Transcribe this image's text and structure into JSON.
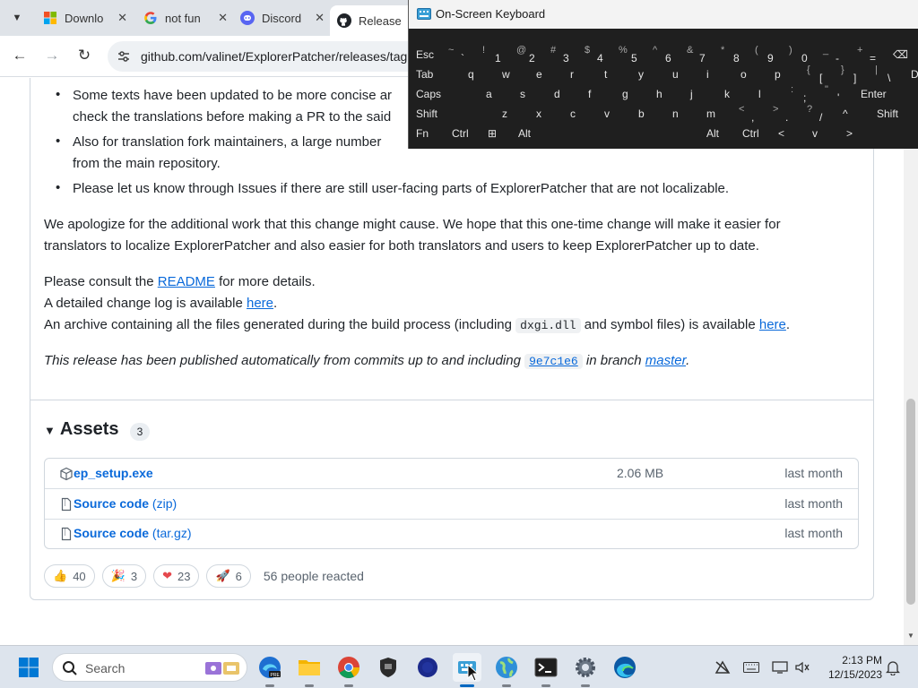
{
  "browser": {
    "tabs": [
      {
        "label": "Downlo",
        "icon": "windows-logo-icon",
        "active": false
      },
      {
        "label": "not fun",
        "icon": "google-icon",
        "active": false
      },
      {
        "label": "Discord",
        "icon": "discord-icon",
        "active": false
      },
      {
        "label": "Release",
        "icon": "github-icon",
        "active": true
      }
    ],
    "close_glyph": "✕",
    "url": "github.com/valinet/ExplorerPatcher/releases/tag"
  },
  "release": {
    "bullet_1": {
      "line_1": "Some texts have been updated to be more concise ar",
      "line_2": "check the translations before making a PR to the said"
    },
    "bullet_2": {
      "line_1": "Also for translation fork maintainers, a large number",
      "line_2": "from the main repository."
    },
    "bullet_3": "Please let us know through Issues if there are still user-facing parts of ExplorerPatcher that are not localizable.",
    "apology_line_1": "We apologize for the additional work that this change might cause. We hope that this one-time change will make it easier for",
    "apology_line_2": "translators to localize ExplorerPatcher and also easier for both translators and users to keep ExplorerPatcher up to date.",
    "consult": {
      "before": "Please consult the ",
      "link": "README",
      "after": " for more details."
    },
    "changelog": {
      "before": "A detailed change log is available ",
      "link": "here",
      "after": "."
    },
    "archive": {
      "before": "An archive containing all the files generated during the build process (including ",
      "code": "dxgi.dll",
      "middle": " and symbol files) is available ",
      "link": "here",
      "after": "."
    },
    "published": {
      "before": "This release has been published automatically from commits up to and including ",
      "sha": "9e7c1e6",
      "middle": " in branch ",
      "branch": "master",
      "after": "."
    }
  },
  "assets": {
    "title": "Assets",
    "count": "3",
    "rows": [
      {
        "name": "ep_setup.exe",
        "sub": "",
        "size": "2.06 MB",
        "date": "last month",
        "icon": "package-icon"
      },
      {
        "name": "Source code",
        "sub": " (zip)",
        "size": "",
        "date": "last month",
        "icon": "file-zip-icon"
      },
      {
        "name": "Source code",
        "sub": " (tar.gz)",
        "size": "",
        "date": "last month",
        "icon": "file-zip-icon"
      }
    ]
  },
  "reactions": {
    "items": [
      {
        "emoji": "👍",
        "count": "40",
        "name": "thumbs-up"
      },
      {
        "emoji": "🎉",
        "count": "3",
        "name": "hooray"
      },
      {
        "emoji": "❤",
        "count": "23",
        "name": "heart"
      },
      {
        "emoji": "🚀",
        "count": "6",
        "name": "rocket"
      }
    ],
    "summary": "56 people reacted"
  },
  "osk": {
    "title": "On-Screen Keyboard",
    "rows": [
      [
        {
          "main": "Esc"
        },
        {
          "main": "`",
          "shift": "~"
        },
        {
          "main": "1",
          "shift": "!"
        },
        {
          "main": "2",
          "shift": "@"
        },
        {
          "main": "3",
          "shift": "#"
        },
        {
          "main": "4",
          "shift": "$"
        },
        {
          "main": "5",
          "shift": "%"
        },
        {
          "main": "6",
          "shift": "^"
        },
        {
          "main": "7",
          "shift": "&"
        },
        {
          "main": "8",
          "shift": "*"
        },
        {
          "main": "9",
          "shift": "("
        },
        {
          "main": "0",
          "shift": ")"
        },
        {
          "main": "-",
          "shift": "_"
        },
        {
          "main": "=",
          "shift": "+"
        },
        {
          "main": "⌫"
        }
      ],
      [
        {
          "main": "Tab"
        },
        {
          "main": "q"
        },
        {
          "main": "w"
        },
        {
          "main": "e"
        },
        {
          "main": "r"
        },
        {
          "main": "t"
        },
        {
          "main": "y"
        },
        {
          "main": "u"
        },
        {
          "main": "i"
        },
        {
          "main": "o"
        },
        {
          "main": "p"
        },
        {
          "main": "[",
          "shift": "{"
        },
        {
          "main": "]",
          "shift": "}"
        },
        {
          "main": "\\",
          "shift": "|"
        },
        {
          "main": "De"
        }
      ],
      [
        {
          "main": "Caps"
        },
        {
          "main": "a"
        },
        {
          "main": "s"
        },
        {
          "main": "d"
        },
        {
          "main": "f"
        },
        {
          "main": "g"
        },
        {
          "main": "h"
        },
        {
          "main": "j"
        },
        {
          "main": "k"
        },
        {
          "main": "l"
        },
        {
          "main": ";",
          "shift": ":"
        },
        {
          "main": "'",
          "shift": "\""
        },
        {
          "main": "Enter"
        }
      ],
      [
        {
          "main": "Shift"
        },
        {
          "main": "z"
        },
        {
          "main": "x"
        },
        {
          "main": "c"
        },
        {
          "main": "v"
        },
        {
          "main": "b"
        },
        {
          "main": "n"
        },
        {
          "main": "m"
        },
        {
          "main": ",",
          "shift": "<"
        },
        {
          "main": ".",
          "shift": ">"
        },
        {
          "main": "/",
          "shift": "?"
        },
        {
          "main": "^"
        },
        {
          "main": "Shift"
        }
      ],
      [
        {
          "main": "Fn"
        },
        {
          "main": "Ctrl"
        },
        {
          "main": "⊞"
        },
        {
          "main": "Alt"
        },
        {
          "main": "Alt"
        },
        {
          "main": "Ctrl"
        },
        {
          "main": "<"
        },
        {
          "main": "v"
        },
        {
          "main": ">"
        }
      ]
    ]
  },
  "taskbar": {
    "search_placeholder": "Search",
    "apps": [
      "start-icon",
      "edge-beta-icon",
      "file-explorer-icon",
      "chrome-icon",
      "shield-app-icon",
      "blue-app-icon",
      "on-screen-keyboard-icon",
      "globe-app-icon",
      "terminal-icon",
      "settings-icon",
      "edge-icon"
    ],
    "time": "2:13 PM",
    "date": "12/15/2023"
  },
  "colors": {
    "link": "#0969da",
    "taskbar": "#dde4ed",
    "osk_bg": "#1f1f1f"
  }
}
